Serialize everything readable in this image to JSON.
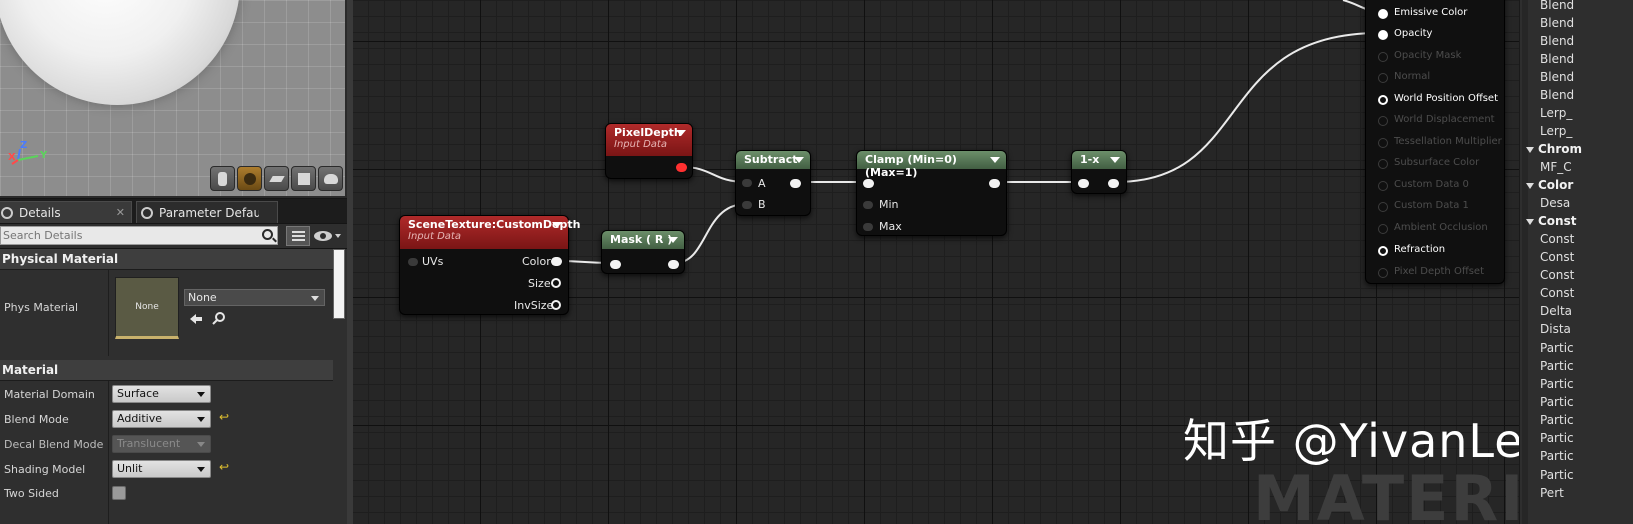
{
  "viewport": {
    "gizmo": {
      "x": "X",
      "y": "Y",
      "z": "Z"
    },
    "buttons": [
      "cylinder-icon",
      "sphere-icon",
      "plane-icon",
      "cube-icon",
      "teapot-icon"
    ]
  },
  "tabs": [
    {
      "label": "Details",
      "close": "✕"
    },
    {
      "label": "Parameter Defaults",
      "close": ""
    }
  ],
  "search": {
    "placeholder": "Search Details"
  },
  "details": {
    "physical_material": {
      "header": "Physical Material",
      "phys_label": "Phys Material",
      "thumb_text": "None",
      "dropdown_value": "None"
    },
    "material": {
      "header": "Material",
      "rows": [
        {
          "label": "Material Domain",
          "value": "Surface",
          "reset": ""
        },
        {
          "label": "Blend Mode",
          "value": "Additive",
          "reset": "↩"
        },
        {
          "label": "Decal Blend Mode",
          "value": "Translucent",
          "reset": ""
        },
        {
          "label": "Shading Model",
          "value": "Unlit",
          "reset": "↩"
        },
        {
          "label": "Two Sided",
          "value": "",
          "reset": ""
        }
      ]
    }
  },
  "graph": {
    "pixel_depth": {
      "title": "PixelDepth",
      "subtitle": "Input Data"
    },
    "scene_texture": {
      "title": "SceneTexture:CustomDepth",
      "subtitle": "Input Data",
      "inputs": [
        "UVs"
      ],
      "outputs": [
        "Color",
        "Size",
        "InvSize"
      ]
    },
    "mask": {
      "title": "Mask ( R )"
    },
    "subtract": {
      "title": "Subtract",
      "inputs": [
        "A",
        "B"
      ]
    },
    "clamp": {
      "title": "Clamp (Min=0) (Max=1)",
      "inputs": [
        "Min",
        "Max"
      ]
    },
    "one_minus": {
      "title": "1-x"
    },
    "material_inputs": [
      {
        "label": "Emissive Color",
        "enabled": true,
        "hollow": false
      },
      {
        "label": "Opacity",
        "enabled": true,
        "hollow": false
      },
      {
        "label": "Opacity Mask",
        "enabled": false
      },
      {
        "label": "Normal",
        "enabled": false
      },
      {
        "label": "World Position Offset",
        "enabled": true,
        "hollow": true
      },
      {
        "label": "World Displacement",
        "enabled": false
      },
      {
        "label": "Tessellation Multiplier",
        "enabled": false
      },
      {
        "label": "Subsurface Color",
        "enabled": false
      },
      {
        "label": "Custom Data 0",
        "enabled": false
      },
      {
        "label": "Custom Data 1",
        "enabled": false
      },
      {
        "label": "Ambient Occlusion",
        "enabled": false
      },
      {
        "label": "Refraction",
        "enabled": true,
        "hollow": true
      },
      {
        "label": "Pixel Depth Offset",
        "enabled": false
      }
    ],
    "watermark": "知乎 @YivanLee",
    "background_text": "MATERIAL"
  },
  "palette": [
    {
      "label": "Blend",
      "cat": false
    },
    {
      "label": "Blend",
      "cat": false
    },
    {
      "label": "Blend",
      "cat": false
    },
    {
      "label": "Blend",
      "cat": false
    },
    {
      "label": "Blend",
      "cat": false
    },
    {
      "label": "Blend",
      "cat": false
    },
    {
      "label": "Lerp_",
      "cat": false
    },
    {
      "label": "Lerp_",
      "cat": false
    },
    {
      "label": "Chrom",
      "cat": true
    },
    {
      "label": "MF_C",
      "cat": false
    },
    {
      "label": "Color",
      "cat": true
    },
    {
      "label": "Desa",
      "cat": false
    },
    {
      "label": "Const",
      "cat": true
    },
    {
      "label": "Const",
      "cat": false
    },
    {
      "label": "Const",
      "cat": false
    },
    {
      "label": "Const",
      "cat": false
    },
    {
      "label": "Const",
      "cat": false
    },
    {
      "label": "Delta",
      "cat": false
    },
    {
      "label": "Dista",
      "cat": false
    },
    {
      "label": "Partic",
      "cat": false
    },
    {
      "label": "Partic",
      "cat": false
    },
    {
      "label": "Partic",
      "cat": false
    },
    {
      "label": "Partic",
      "cat": false
    },
    {
      "label": "Partic",
      "cat": false
    },
    {
      "label": "Partic",
      "cat": false
    },
    {
      "label": "Partic",
      "cat": false
    },
    {
      "label": "Partic",
      "cat": false
    },
    {
      "label": "Pert",
      "cat": false
    }
  ],
  "colors": {
    "accent": "#c9b26c",
    "input_node": "#9a2222",
    "math_node": "#5c7d5c",
    "wire": "#e8e8e8"
  }
}
